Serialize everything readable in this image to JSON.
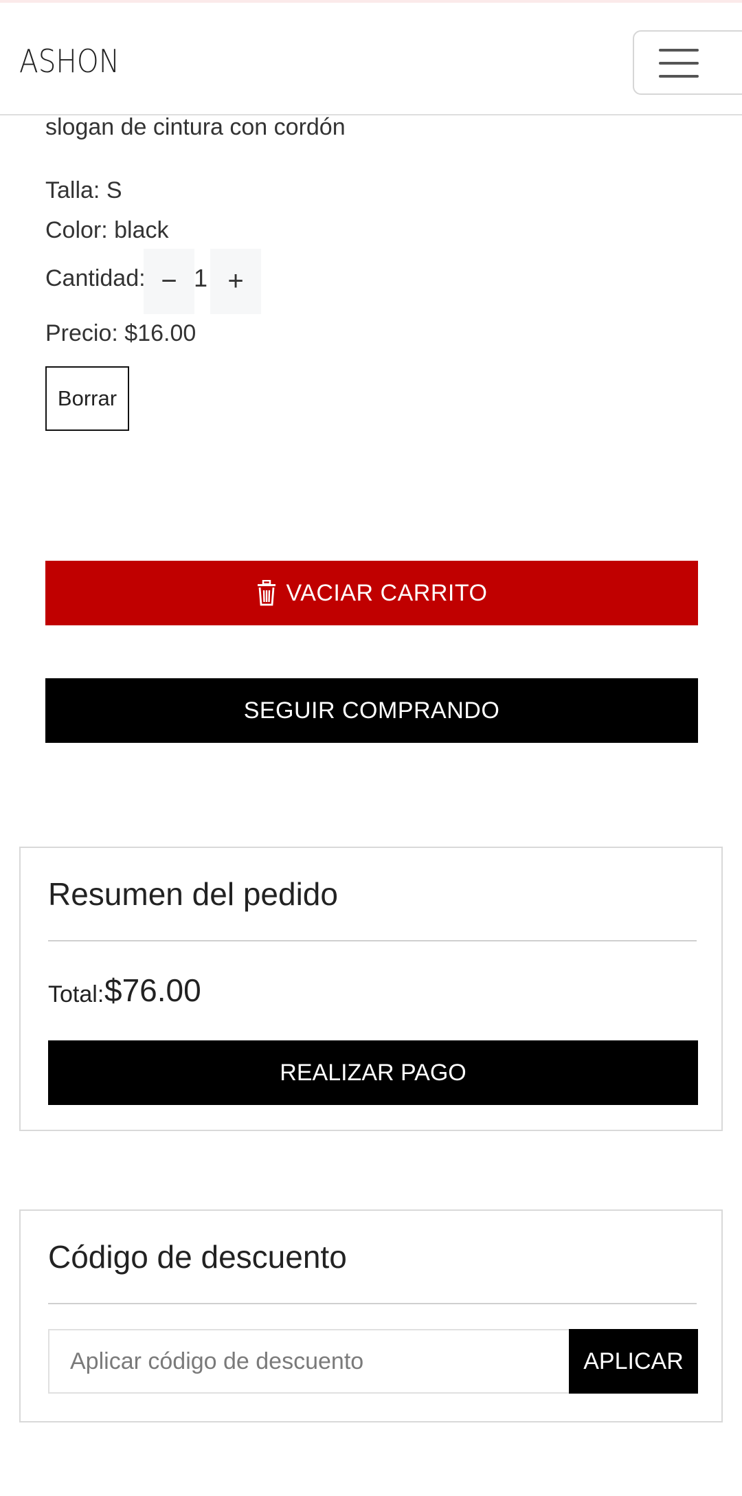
{
  "navbar": {
    "brand": "ASHON",
    "menu_icon": "hamburger-menu-icon"
  },
  "cart_item": {
    "name_tail": "slogan de cintura con cordón",
    "size": "Talla: S",
    "color": "Color: black",
    "quantity_label": "Cantidad:",
    "decrement_symbol": "−",
    "quantity_value": "1",
    "increment_symbol": "+",
    "price": "Precio: $16.00",
    "delete_label": "Borrar"
  },
  "actions": {
    "empty_cart_icon": "trash-icon",
    "empty_cart_label": "VACIAR CARRITO",
    "continue_shopping_label": "SEGUIR COMPRANDO",
    "empty_cart_color": "#c00000"
  },
  "order_summary": {
    "title": "Resumen del pedido",
    "total_label": "Total:",
    "total_value": "$76.00",
    "pay_label": "REALIZAR PAGO"
  },
  "discount": {
    "title": "Código de descuento",
    "placeholder": "Aplicar código de descuento",
    "value": "",
    "apply_label": "APLICAR"
  }
}
